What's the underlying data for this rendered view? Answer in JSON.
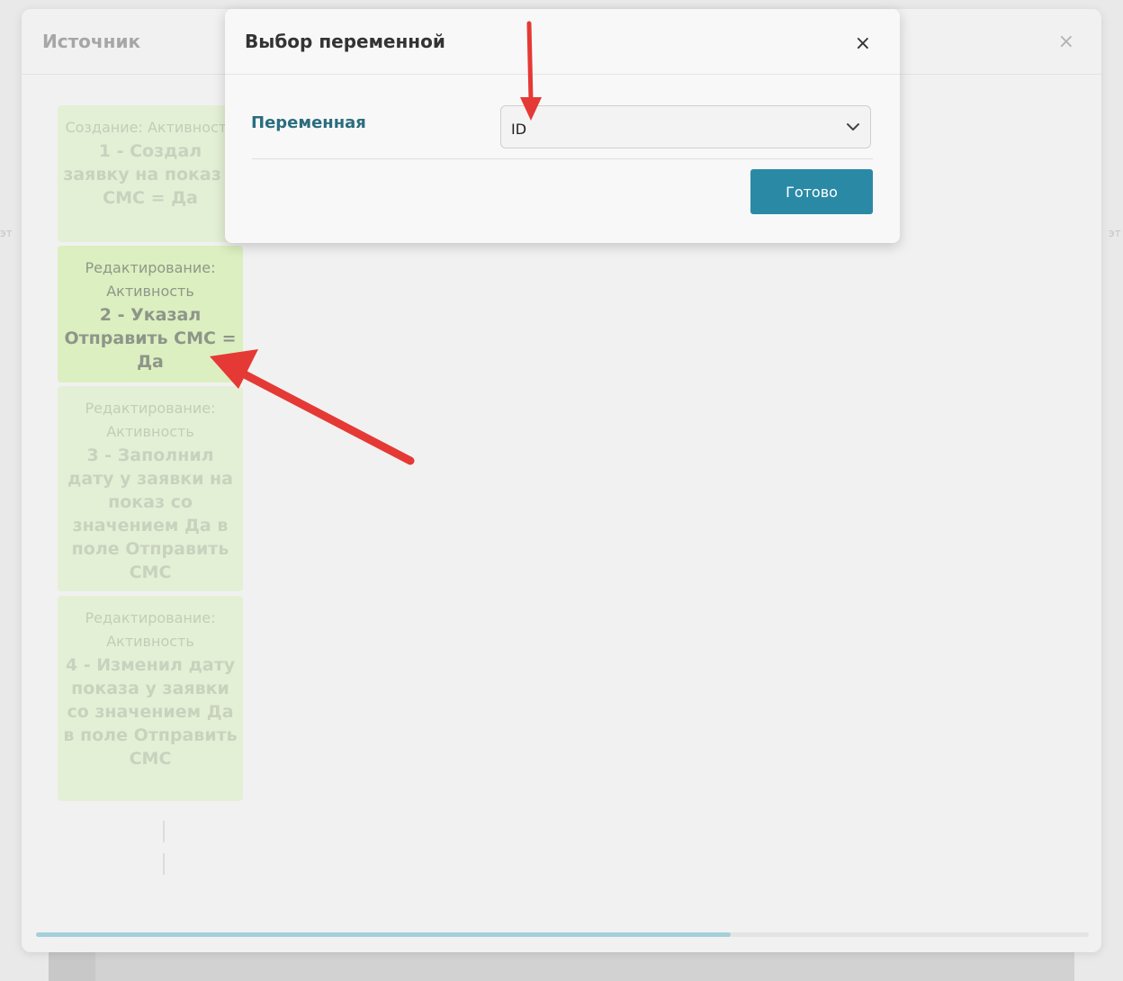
{
  "background": {
    "edge_left": "эт",
    "edge_right": "эт"
  },
  "source_modal": {
    "title": "Источник",
    "close_glyph": "×",
    "cards": [
      {
        "kind": "Создание: Активность",
        "name": "1 - Создал заявку на показ с СМС = Да"
      },
      {
        "kind": "Редактирование: Активность",
        "name": "2 - Указал Отправить СМС = Да"
      },
      {
        "kind": "Редактирование: Активность",
        "name": "3 - Заполнил дату у заявки на показ со значением Да в поле Отправить СМС"
      },
      {
        "kind": "Редактирование: Активность",
        "name": "4 - Изменил дату показа у заявки со значением Да в поле Отправить СМС"
      }
    ],
    "active_card_index": 1,
    "scroll_progress": 0.66
  },
  "variable_modal": {
    "title": "Выбор переменной",
    "close_glyph": "×",
    "field_label": "Переменная",
    "selected_value": "ID",
    "done_label": "Готово"
  },
  "colors": {
    "accent": "#2a8aa6",
    "label": "#2b6d7e",
    "card_bg": "#e4f0d5",
    "card_active_bg": "#dcefc0",
    "annotation_arrow": "#e53935"
  }
}
